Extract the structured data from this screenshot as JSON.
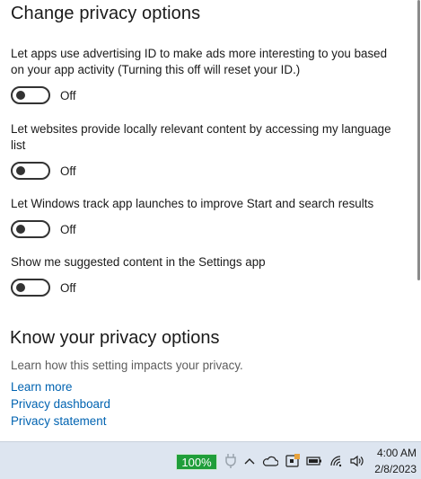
{
  "section_title": "Change privacy options",
  "options": [
    {
      "description": "Let apps use advertising ID to make ads more interesting to you based on your app activity (Turning this off will reset your ID.)",
      "state": "Off"
    },
    {
      "description": "Let websites provide locally relevant content by accessing my language list",
      "state": "Off"
    },
    {
      "description": "Let Windows track app launches to improve Start and search results",
      "state": "Off"
    },
    {
      "description": "Show me suggested content in the Settings app",
      "state": "Off"
    }
  ],
  "know_section": {
    "title": "Know your privacy options",
    "info": "Learn how this setting impacts your privacy.",
    "links": [
      "Learn more",
      "Privacy dashboard",
      "Privacy statement"
    ]
  },
  "taskbar": {
    "battery_percent": "100%",
    "time": "4:00 AM",
    "date": "2/8/2023",
    "tray_icons": [
      "plug-icon",
      "chevron-up-icon",
      "onedrive-cloud-icon",
      "device-app-icon",
      "battery-icon",
      "wifi-icon",
      "volume-icon"
    ]
  },
  "colors": {
    "link": "#0063b1",
    "battery_badge": "#1f9e3a",
    "taskbar_bg": "#dde5f0"
  }
}
